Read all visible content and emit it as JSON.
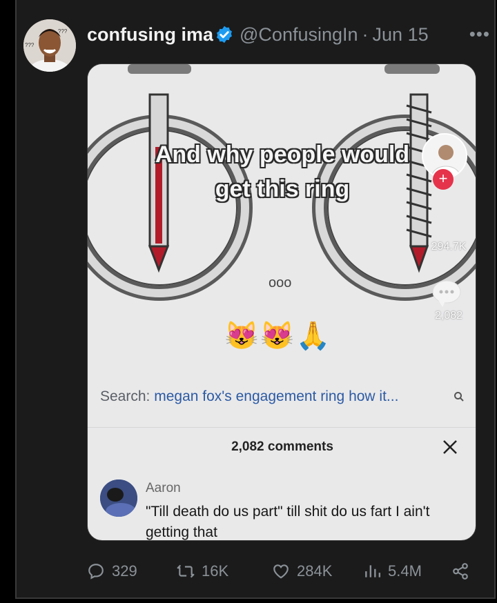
{
  "tweet": {
    "author_name": "confusing ima",
    "handle": "@ConfusingIn",
    "separator": "·",
    "date": "Jun 15",
    "more_label": "•••"
  },
  "media": {
    "overlay_line1": "And why people would",
    "overlay_line2": "get this ring",
    "emojis": "😻😻🙏",
    "dots": "ooo",
    "like_count": "294.7K",
    "comment_count": "2,082",
    "search_prefix": "Search: ",
    "search_term": "megan fox's engagement ring how it...",
    "comments_title": "2,082 comments",
    "comment_author": "Aaron",
    "comment_text": "\"Till death do us part\" till shit do us fart I ain't getting that"
  },
  "actions": {
    "replies": "329",
    "retweets": "16K",
    "likes": "284K",
    "views": "5.4M"
  },
  "colors": {
    "background": "#1b1b1b",
    "verified": "#1d9bf0",
    "muted": "#8b9298",
    "search_term": "#2c5aa3",
    "follow_plus": "#e5334b"
  }
}
